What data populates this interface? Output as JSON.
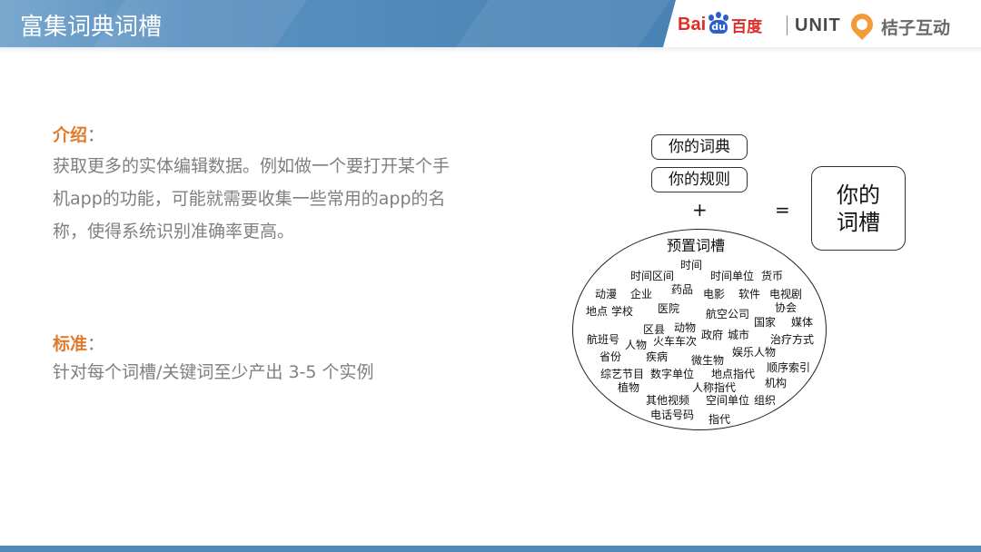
{
  "header": {
    "title": "富集词典词槽",
    "logos": {
      "baidu_left": "Bai",
      "baidu_paw": "du",
      "baidu_cn": "百度",
      "unit": "UNIT",
      "juzi": "桔子互动"
    }
  },
  "intro": {
    "label": "介绍",
    "colon": "：",
    "lines": [
      "获取更多的实体编辑数据。例如做一个要打开某个手",
      "机app的功能，可能就需要收集一些常用的app的名",
      "称，使得系统识别准确率更高。"
    ]
  },
  "standard": {
    "label": "标准",
    "colon": "：",
    "text": "针对每个词槽/关键词至少产出 3-5 个实例"
  },
  "diagram": {
    "dict_box": "你的词典",
    "rules_box": "你的规则",
    "plus": "+",
    "equals": "=",
    "result": [
      "你的",
      "词槽"
    ],
    "preset_title": "预置词槽",
    "words": [
      "时间",
      "时间区间",
      "时间单位",
      "货币",
      "动漫",
      "企业",
      "药品",
      "电影",
      "软件",
      "电视剧",
      "地点",
      "学校",
      "医院",
      "航空公司",
      "协会",
      "国家",
      "媒体",
      "区县",
      "动物",
      "政府",
      "城市",
      "航班号",
      "人物",
      "火车车次",
      "治疗方式",
      "省份",
      "疾病",
      "微生物",
      "娱乐人物",
      "综艺节目",
      "数字单位",
      "地点指代",
      "顺序索引",
      "植物",
      "人称指代",
      "机构",
      "其他视频",
      "空间单位",
      "组织",
      "电话号码",
      "指代"
    ]
  },
  "colors": {
    "accent": "#e07b2c",
    "header": "#4d86b6",
    "text_gray": "#7f7f7f"
  }
}
